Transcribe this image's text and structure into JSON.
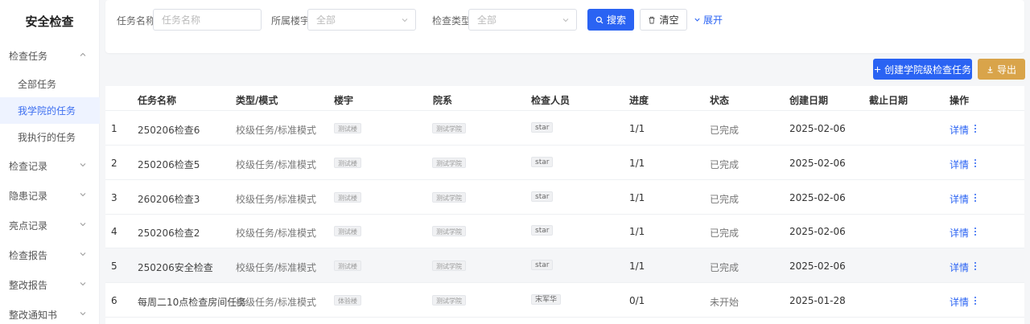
{
  "app": {
    "title": "安全检查"
  },
  "sidebar": {
    "groups": [
      {
        "label": "检查任务",
        "expanded": true
      },
      {
        "label": "检查记录",
        "expanded": false
      },
      {
        "label": "隐患记录",
        "expanded": false
      },
      {
        "label": "亮点记录",
        "expanded": false
      },
      {
        "label": "检查报告",
        "expanded": false
      },
      {
        "label": "整改报告",
        "expanded": false
      },
      {
        "label": "整改通知书",
        "expanded": false
      }
    ],
    "sub_items": [
      {
        "label": "全部任务",
        "active": false
      },
      {
        "label": "我学院的任务",
        "active": true
      },
      {
        "label": "我执行的任务",
        "active": false
      }
    ]
  },
  "filters": {
    "task_name": {
      "label": "任务名称",
      "placeholder": "任务名称"
    },
    "building": {
      "label": "所属楼宇",
      "placeholder": "全部"
    },
    "check_type": {
      "label": "检查类型",
      "placeholder": "全部"
    },
    "search_label": "搜索",
    "clear_label": "清空",
    "expand_label": "展开"
  },
  "actions": {
    "create_label": "创建学院级检查任务",
    "export_label": "导出"
  },
  "table": {
    "headers": [
      "任务名称",
      "类型/模式",
      "楼宇",
      "院系",
      "检查人员",
      "进度",
      "状态",
      "创建日期",
      "截止日期",
      "操作"
    ],
    "rows": [
      {
        "index": "1",
        "name": "250206检查6",
        "type": "校级任务/标准模式",
        "building": "测试楼",
        "dept": "测试学院",
        "inspector": "star",
        "progress": "1/1",
        "status": "已完成",
        "created": "2025-02-06",
        "deadline": "",
        "action": "详情"
      },
      {
        "index": "2",
        "name": "250206检查5",
        "type": "校级任务/标准模式",
        "building": "测试楼",
        "dept": "测试学院",
        "inspector": "star",
        "progress": "1/1",
        "status": "已完成",
        "created": "2025-02-06",
        "deadline": "",
        "action": "详情"
      },
      {
        "index": "3",
        "name": "260206检查3",
        "type": "校级任务/标准模式",
        "building": "测试楼",
        "dept": "测试学院",
        "inspector": "star",
        "progress": "1/1",
        "status": "已完成",
        "created": "2025-02-06",
        "deadline": "",
        "action": "详情"
      },
      {
        "index": "4",
        "name": "250206检查2",
        "type": "校级任务/标准模式",
        "building": "测试楼",
        "dept": "测试学院",
        "inspector": "star",
        "progress": "1/1",
        "status": "已完成",
        "created": "2025-02-06",
        "deadline": "",
        "action": "详情"
      },
      {
        "index": "5",
        "name": "250206安全检查",
        "type": "校级任务/标准模式",
        "building": "测试楼",
        "dept": "测试学院",
        "inspector": "star",
        "progress": "1/1",
        "status": "已完成",
        "created": "2025-02-06",
        "deadline": "",
        "action": "详情"
      },
      {
        "index": "6",
        "name": "每周二10点检查房间任务",
        "type": "校级任务/标准模式",
        "building": "体验楼",
        "dept": "测试学院",
        "inspector": "宋军华",
        "progress": "0/1",
        "status": "未开始",
        "created": "2025-01-28",
        "deadline": "",
        "action": "详情"
      }
    ]
  },
  "colors": {
    "primary": "#2a63f3",
    "export": "#d9a44a",
    "active_bg": "#eef3ff"
  }
}
